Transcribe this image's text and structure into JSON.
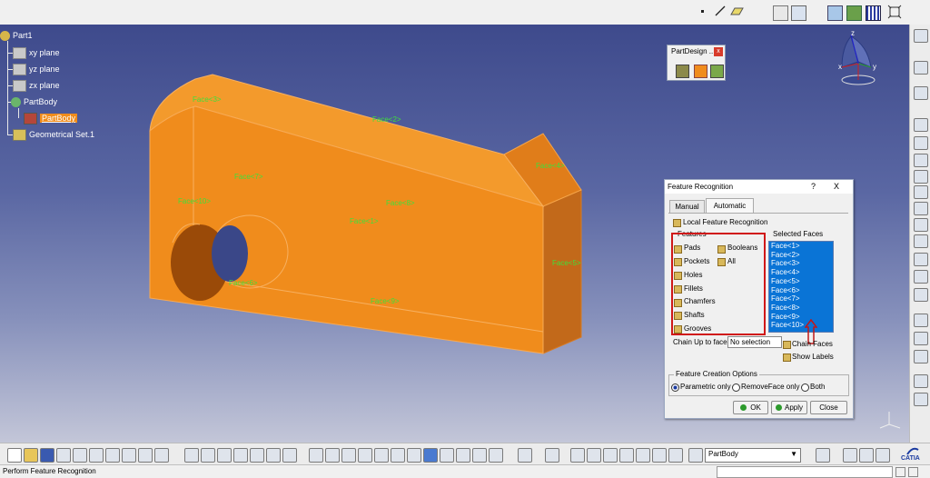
{
  "tree": {
    "root": "Part1",
    "items": [
      "xy plane",
      "yz plane",
      "zx plane",
      "PartBody"
    ],
    "selected": "PartBody",
    "geometrical_set": "Geometrical Set.1"
  },
  "faces": [
    "Face<1>",
    "Face<2>",
    "Face<3>",
    "Face<4>",
    "Face<5>",
    "Face<6>",
    "Face<7>",
    "Face<8>",
    "Face<9>",
    "Face<10>"
  ],
  "partdesign_toolbar": {
    "title": "PartDesign ...",
    "close": "x"
  },
  "dialog": {
    "title": "Feature Recognition",
    "help": "?",
    "close": "X",
    "tabs": [
      "Manual",
      "Automatic"
    ],
    "local_feature_recognition": "Local Feature Recognition",
    "features_group": "Features",
    "features_left": [
      "Pads",
      "Pockets",
      "Holes",
      "Fillets",
      "Chamfers",
      "Shafts",
      "Grooves"
    ],
    "features_right": [
      "Booleans",
      "All"
    ],
    "selected_faces_label": "Selected Faces",
    "chain_up_label": "Chain Up to faces",
    "chain_up_value": "No selection",
    "chain_faces": "Chain Faces",
    "show_labels": "Show Labels",
    "creation_options_label": "Feature Creation Options",
    "options": [
      "Parametric only",
      "RemoveFace only",
      "Both"
    ],
    "buttons": {
      "ok": "OK",
      "apply": "Apply",
      "close": "Close"
    }
  },
  "bottom": {
    "body_select": "PartBody",
    "catia": "CATIA"
  },
  "status": {
    "text": "Perform Feature Recognition"
  },
  "compass": {
    "x": "x",
    "y": "y",
    "z": "z"
  },
  "colors": {
    "part": "#f08c1c",
    "face_label": "#3fe03a",
    "selection": "#0a74d6",
    "highlight_box": "#d01818"
  }
}
